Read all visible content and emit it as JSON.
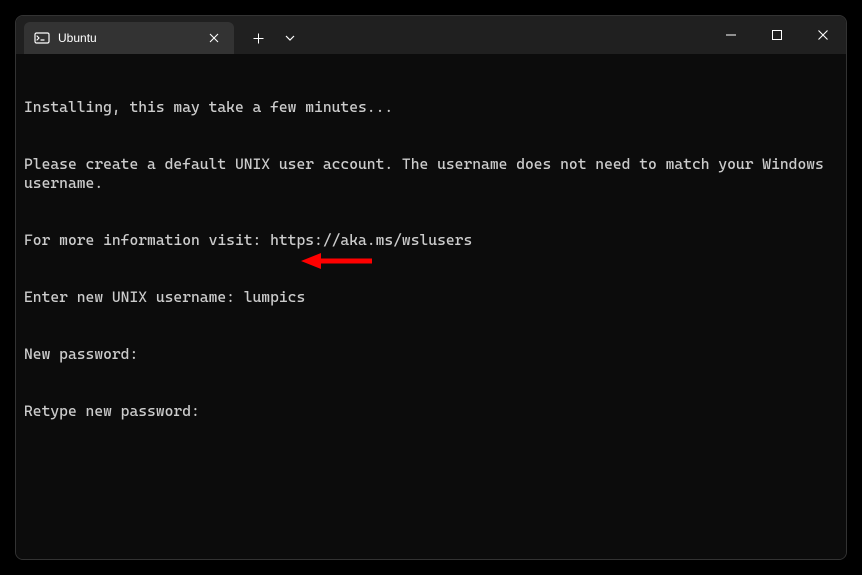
{
  "titlebar": {
    "tab_title": "Ubuntu",
    "new_tab_label": "+",
    "dropdown_label": "⌄"
  },
  "terminal": {
    "lines": [
      "Installing, this may take a few minutes...",
      "Please create a default UNIX user account. The username does not need to match your Windows username.",
      "For more information visit: https://aka.ms/wslusers",
      "Enter new UNIX username: lumpics",
      "New password:",
      "Retype new password:"
    ]
  }
}
